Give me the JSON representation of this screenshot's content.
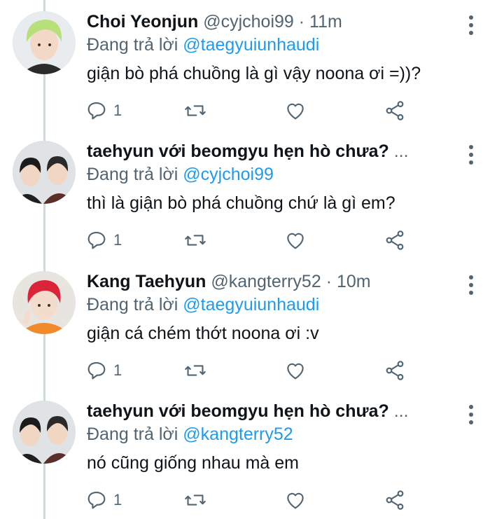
{
  "tweets": [
    {
      "name": "Choi Yeonjun",
      "handle": "@cyjchoi99",
      "dot": " · ",
      "time": "11m",
      "replying_prefix": "Đang trả lời ",
      "replying_to": "@taegyuiunhaudi",
      "text": "giận bò phá chuồng là gì vậy noona ơi =))?",
      "reply_count": "1",
      "avatar": "green-hair"
    },
    {
      "name": "taehyun với beomgyu hẹn hò chưa?",
      "handle": " ...",
      "dot": "",
      "time": "",
      "replying_prefix": "Đang trả lời ",
      "replying_to": "@cyjchoi99",
      "text": "thì là giận bò phá chuồng chứ là gì em?",
      "reply_count": "1",
      "avatar": "duo"
    },
    {
      "name": "Kang Taehyun",
      "handle": "@kangterry52",
      "dot": " · ",
      "time": "10m",
      "replying_prefix": "Đang trả lời ",
      "replying_to": "@taegyuiunhaudi",
      "text": "giận cá chém thớt noona ơi :v",
      "reply_count": "1",
      "avatar": "red-hair"
    },
    {
      "name": "taehyun với beomgyu hẹn hò chưa?",
      "handle": " ...",
      "dot": "",
      "time": "",
      "replying_prefix": "Đang trả lời ",
      "replying_to": "@kangterry52",
      "text": "nó cũng giống nhau mà em",
      "reply_count": "1",
      "avatar": "duo"
    }
  ],
  "icons": {
    "reply": "reply-icon",
    "retweet": "retweet-icon",
    "like": "like-icon",
    "share": "share-icon",
    "more": "more-icon"
  },
  "colors": {
    "text": "#0f1419",
    "secondary": "#536471",
    "mention": "#1d9bf0",
    "thread_line": "#cfd9de"
  }
}
